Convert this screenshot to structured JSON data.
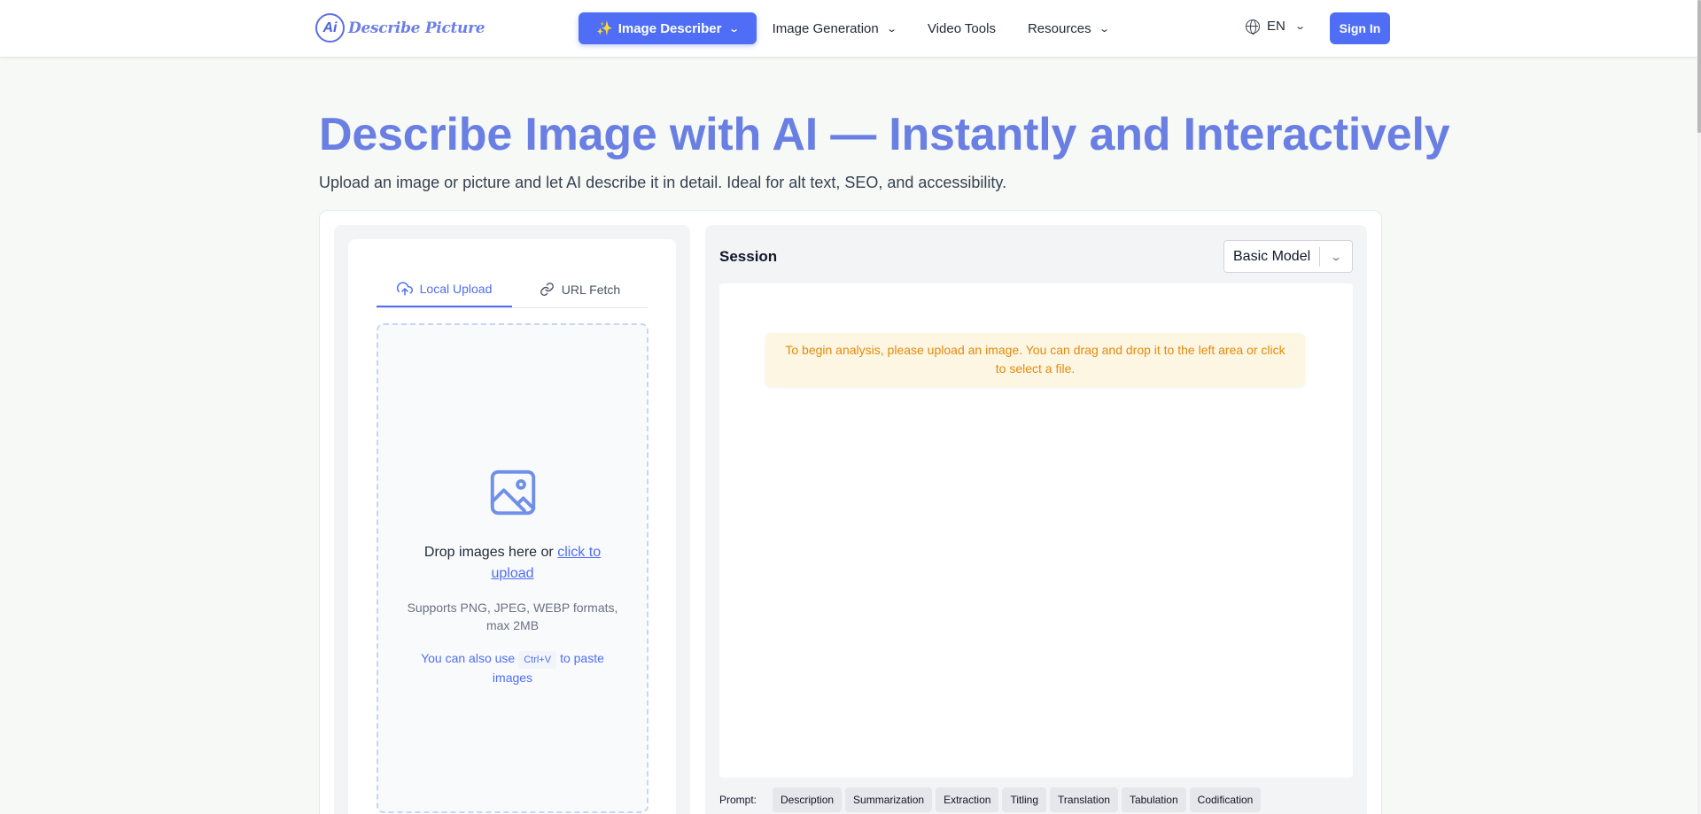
{
  "header": {
    "logo_mark": "Ai",
    "logo_text": "Describe Picture",
    "nav": [
      {
        "label": "Image Describer",
        "icon": "✨",
        "active": true,
        "dropdown": true
      },
      {
        "label": "Image Generation",
        "dropdown": true
      },
      {
        "label": "Video Tools",
        "dropdown": false
      },
      {
        "label": "Resources",
        "dropdown": true
      }
    ],
    "language": "EN",
    "sign_in": "Sign In"
  },
  "hero": {
    "title": "Describe Image with AI — Instantly and Interactively",
    "subtitle": "Upload an image or picture and let AI describe it in detail. Ideal for alt text, SEO, and accessibility."
  },
  "upload": {
    "tabs": [
      {
        "label": "Local Upload",
        "icon": "cloud-upload-icon",
        "active": true
      },
      {
        "label": "URL Fetch",
        "icon": "link-icon",
        "active": false
      }
    ],
    "drop_text": "Drop images here or",
    "click_text": "click to upload",
    "formats": "Supports PNG, JPEG, WEBP formats, max 2MB",
    "paste_prefix": "You can also use",
    "paste_key": "Ctrl+V",
    "paste_suffix": "to paste images"
  },
  "session": {
    "title": "Session",
    "model": "Basic Model",
    "notice": "To begin analysis, please upload an image. You can drag and drop it to the left area or click to select a file."
  },
  "prompt": {
    "label": "Prompt:",
    "chips": [
      "Description",
      "Summarization",
      "Extraction",
      "Titling",
      "Translation",
      "Tabulation",
      "Codification"
    ]
  },
  "colors": {
    "accent": "#4f6ef5",
    "title": "#6a7fe3",
    "notice_text": "#e58a0a",
    "notice_bg": "#fdf6e3"
  }
}
